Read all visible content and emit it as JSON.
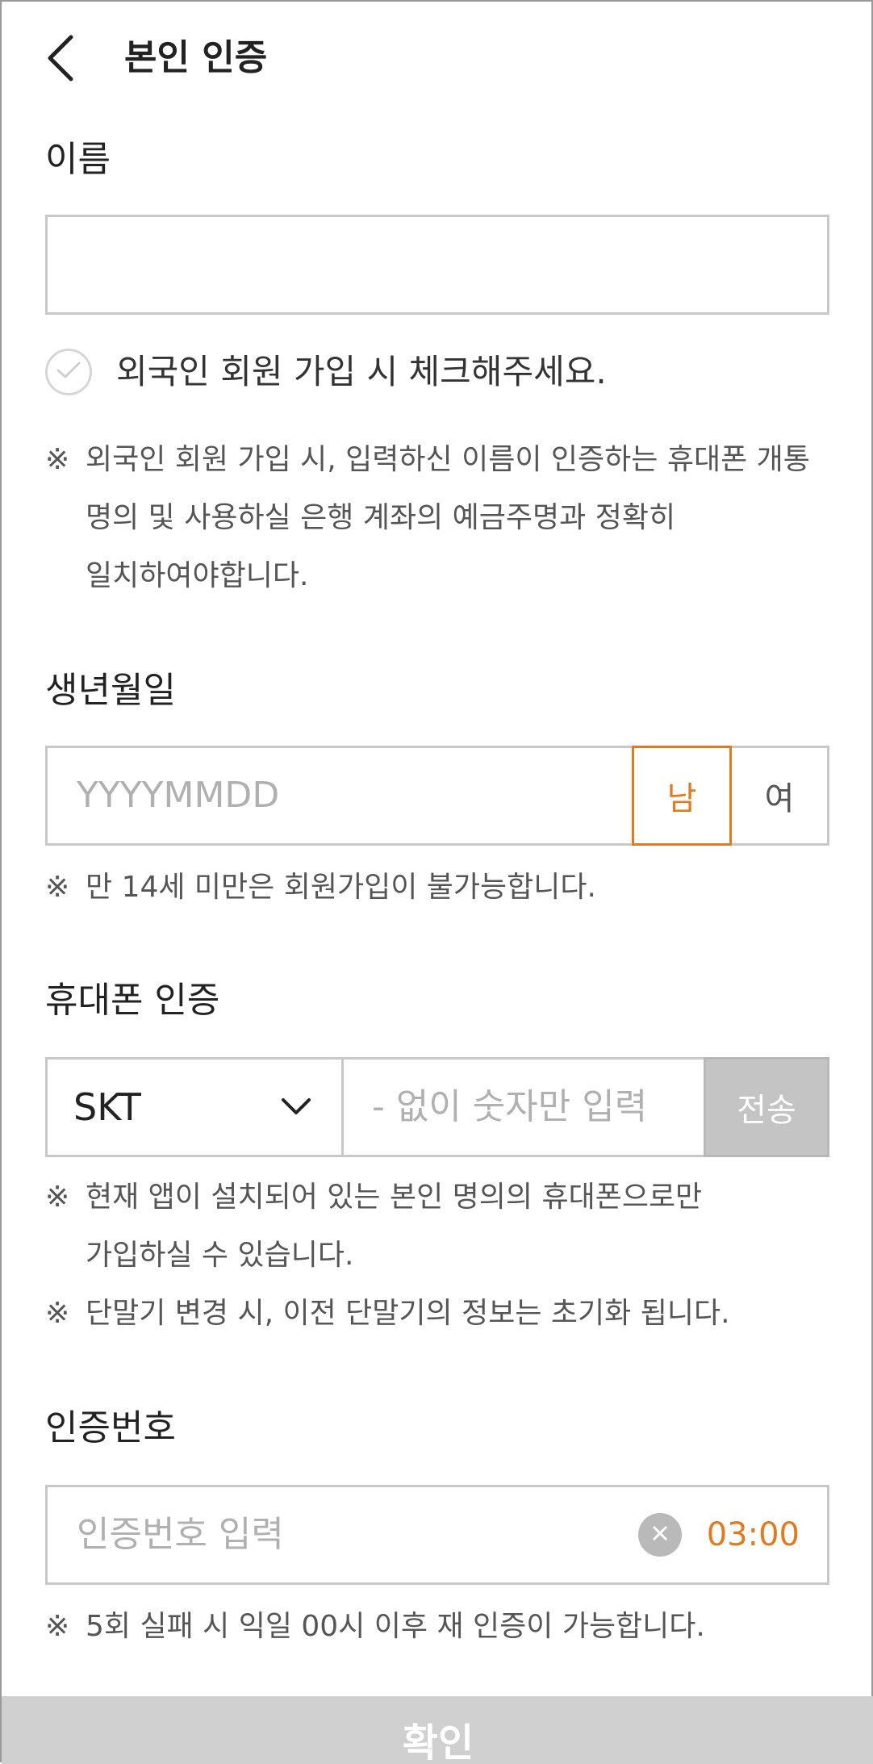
{
  "header": {
    "title": "본인 인증"
  },
  "name": {
    "label": "이름",
    "value": ""
  },
  "foreigner": {
    "check_label": "외국인 회원 가입 시 체크해주세요.",
    "note_mark": "※",
    "note_lines": [
      "외국인 회원 가입 시, 입력하신 이름이 인증하는 휴대폰 개통",
      "명의 및 사용하실 은행 계좌의 예금주명과 정확히",
      "일치하여야합니다."
    ]
  },
  "birth": {
    "label": "생년월일",
    "placeholder": "YYYYMMDD",
    "male": "남",
    "female": "여",
    "note_mark": "※",
    "note": "만 14세 미만은 회원가입이 불가능합니다."
  },
  "phone": {
    "label": "휴대폰 인증",
    "carrier": "SKT",
    "placeholder": "- 없이 숫자만 입력",
    "send": "전송",
    "note_mark": "※",
    "note1_lines": [
      "현재 앱이 설치되어 있는 본인 명의의 휴대폰으로만",
      "가입하실 수 있습니다."
    ],
    "note2": "단말기 변경 시, 이전 단말기의 정보는 초기화 됩니다."
  },
  "auth": {
    "label": "인증번호",
    "placeholder": "인증번호 입력",
    "timer": "03:00",
    "note_mark": "※",
    "note": "5회 실패 시 익일 00시 이후 재 인증이 가능합니다."
  },
  "confirm": {
    "label": "확인"
  },
  "colors": {
    "accent": "#e07b22",
    "border": "#c8c8c8",
    "disabled": "#c4c4c4"
  }
}
